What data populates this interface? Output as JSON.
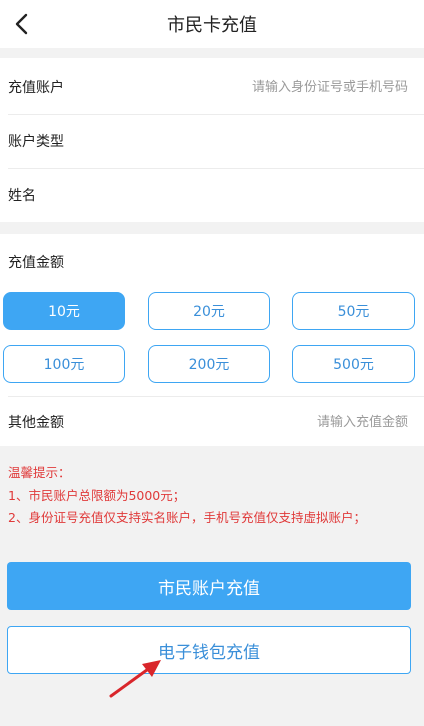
{
  "header": {
    "title": "市民卡充值"
  },
  "account": {
    "label": "充值账户",
    "placeholder": "请输入身份证号或手机号码",
    "type_label": "账户类型",
    "name_label": "姓名"
  },
  "amount": {
    "section_title": "充值金额",
    "options": [
      "10元",
      "20元",
      "50元",
      "100元",
      "200元",
      "500元"
    ],
    "selected": "10元",
    "other_label": "其他金额",
    "other_placeholder": "请输入充值金额"
  },
  "tips": {
    "title": "温馨提示：",
    "items": [
      "1、市民账户总限额为5000元；",
      "2、身份证号充值仅支持实名账户，手机号充值仅支持虚拟账户；"
    ]
  },
  "actions": {
    "citizen_recharge": "市民账户充值",
    "wallet_recharge": "电子钱包充值"
  },
  "colors": {
    "accent": "#3ea6f3",
    "warning": "#e03a3a",
    "annotation": "#d9262b"
  },
  "icons": {
    "back": "chevron-left-icon",
    "annotation": "red-arrow-icon"
  }
}
